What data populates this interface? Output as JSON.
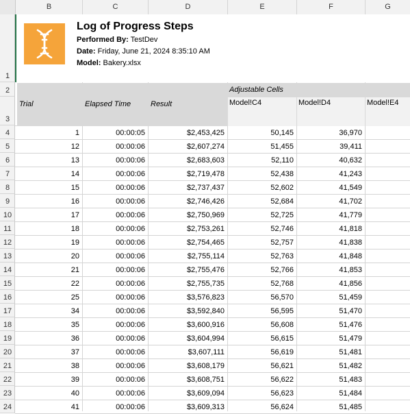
{
  "columns": [
    "B",
    "C",
    "D",
    "E",
    "F",
    "G"
  ],
  "row_numbers": [
    "1",
    "2",
    "3",
    "4",
    "5",
    "6",
    "7",
    "8",
    "9",
    "10",
    "11",
    "12",
    "13",
    "14",
    "15",
    "16",
    "17",
    "18",
    "19",
    "20",
    "21",
    "22",
    "23",
    "24"
  ],
  "report": {
    "title": "Log of Progress Steps",
    "performed_by_label": "Performed By:",
    "performed_by": "TestDev",
    "date_label": "Date:",
    "date": "Friday, June 21, 2024 8:35:10 AM",
    "model_label": "Model:",
    "model": "Bakery.xlsx",
    "logo_icon": "dna-icon",
    "logo_color": "#f5a43a"
  },
  "headers": {
    "trial": "Trial",
    "elapsed": "Elapsed Time",
    "result": "Result",
    "adjustable": "Adjustable Cells",
    "c4": "Model!C4",
    "d4": "Model!D4",
    "e4": "Model!E4"
  },
  "rows": [
    [
      "1",
      "00:00:05",
      "$2,453,425",
      "50,145",
      "36,970"
    ],
    [
      "12",
      "00:00:06",
      "$2,607,274",
      "51,455",
      "39,411"
    ],
    [
      "13",
      "00:00:06",
      "$2,683,603",
      "52,110",
      "40,632"
    ],
    [
      "14",
      "00:00:06",
      "$2,719,478",
      "52,438",
      "41,243"
    ],
    [
      "15",
      "00:00:06",
      "$2,737,437",
      "52,602",
      "41,549"
    ],
    [
      "16",
      "00:00:06",
      "$2,746,426",
      "52,684",
      "41,702"
    ],
    [
      "17",
      "00:00:06",
      "$2,750,969",
      "52,725",
      "41,779"
    ],
    [
      "18",
      "00:00:06",
      "$2,753,261",
      "52,746",
      "41,818"
    ],
    [
      "19",
      "00:00:06",
      "$2,754,465",
      "52,757",
      "41,838"
    ],
    [
      "20",
      "00:00:06",
      "$2,755,114",
      "52,763",
      "41,848"
    ],
    [
      "21",
      "00:00:06",
      "$2,755,476",
      "52,766",
      "41,853"
    ],
    [
      "22",
      "00:00:06",
      "$2,755,735",
      "52,768",
      "41,856"
    ],
    [
      "25",
      "00:00:06",
      "$3,576,823",
      "56,570",
      "51,459"
    ],
    [
      "34",
      "00:00:06",
      "$3,592,840",
      "56,595",
      "51,470"
    ],
    [
      "35",
      "00:00:06",
      "$3,600,916",
      "56,608",
      "51,476"
    ],
    [
      "36",
      "00:00:06",
      "$3,604,994",
      "56,615",
      "51,479"
    ],
    [
      "37",
      "00:00:06",
      "$3,607,111",
      "56,619",
      "51,481"
    ],
    [
      "38",
      "00:00:06",
      "$3,608,179",
      "56,621",
      "51,482"
    ],
    [
      "39",
      "00:00:06",
      "$3,608,751",
      "56,622",
      "51,483"
    ],
    [
      "40",
      "00:00:06",
      "$3,609,094",
      "56,623",
      "51,484"
    ],
    [
      "41",
      "00:00:06",
      "$3,609,313",
      "56,624",
      "51,485"
    ]
  ]
}
